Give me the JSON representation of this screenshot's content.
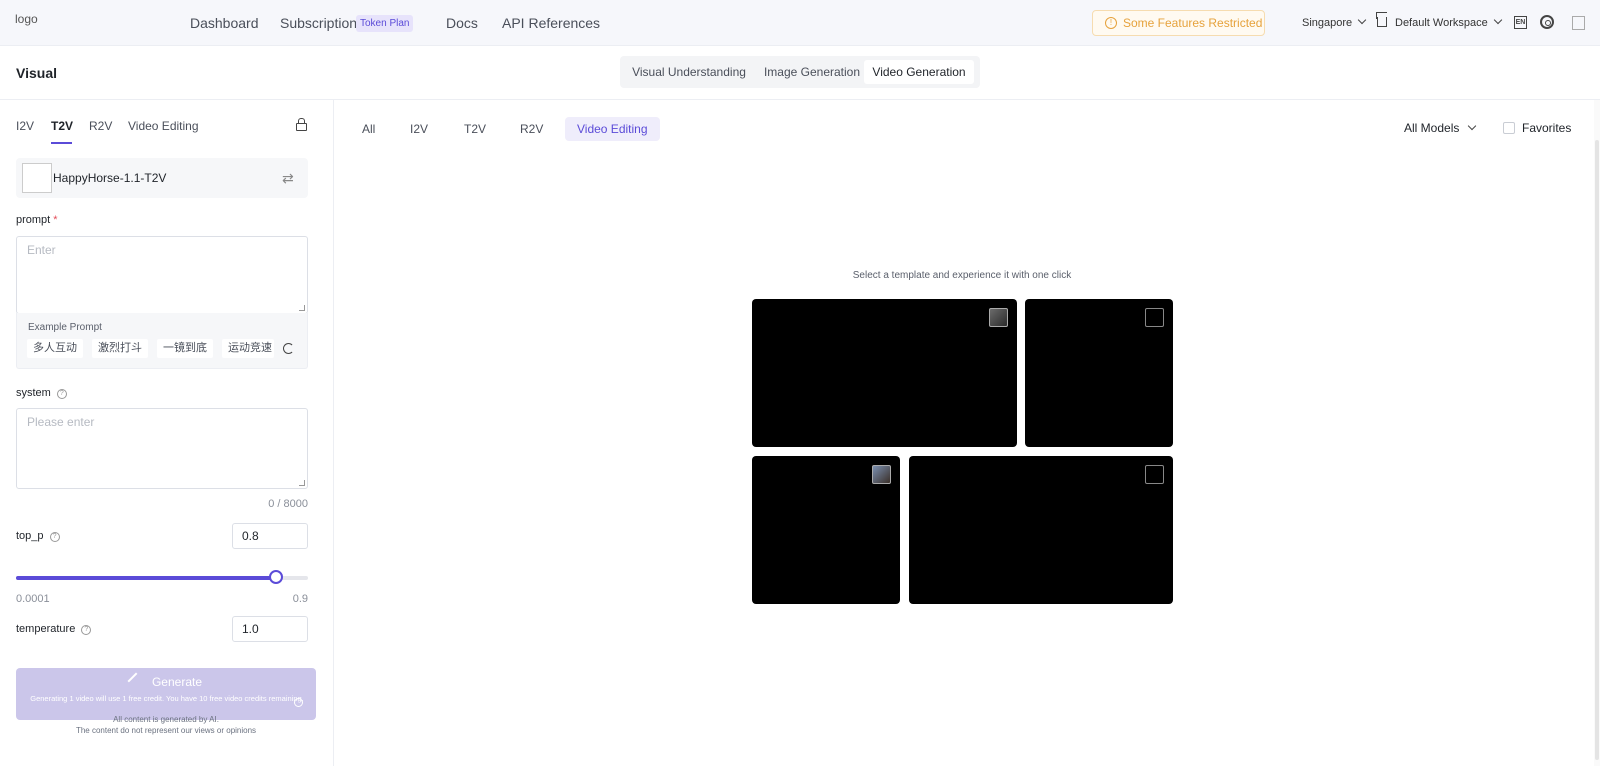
{
  "topnav": {
    "logo_alt": "logo",
    "links": [
      "Dashboard",
      "Subscription",
      "Docs",
      "API References"
    ],
    "subscription_badge": "Token Plan",
    "restricted_notice": "Some Features Restricted",
    "region": "Singapore",
    "workspace": "Default Workspace",
    "language_icon_text": "EN"
  },
  "page": {
    "title": "Visual",
    "segments": [
      "Visual Understanding",
      "Image Generation",
      "Video Generation"
    ],
    "active_segment": "Video Generation"
  },
  "left": {
    "tabs": [
      "I2V",
      "T2V",
      "R2V",
      "Video Editing"
    ],
    "active_tab": "T2V",
    "model_name": "HappyHorse-1.1-T2V",
    "prompt_label": "prompt",
    "prompt_required_mark": "*",
    "prompt_placeholder": "Enter",
    "example_title": "Example Prompt",
    "example_chips": [
      "多人互动",
      "激烈打斗",
      "一镜到底",
      "运动竞速"
    ],
    "system_label": "system",
    "system_placeholder": "Please enter",
    "system_counter": "0 / 8000",
    "top_p_label": "top_p",
    "top_p_value": "0.8",
    "top_p_min": "0.0001",
    "top_p_max": "0.9",
    "top_p_fraction": 0.889,
    "temperature_label": "temperature",
    "temperature_value": "1.0",
    "generate_label": "Generate",
    "generate_note": "Generating 1 video will use 1 free credit. You have 10 free video credits remaining.",
    "disclaimer_1": "All content is generated by AI.",
    "disclaimer_2": "The content do not represent our views or opinions"
  },
  "main": {
    "filter_tabs": [
      "All",
      "I2V",
      "T2V",
      "R2V",
      "Video Editing"
    ],
    "active_filter": "Video Editing",
    "model_filter": "All Models",
    "favorites_label": "Favorites",
    "hint": "Select a template and experience it with one click",
    "template_count": 4
  },
  "colors": {
    "accent": "#5b4bd8",
    "warning": "#e6a23c",
    "template_bg": "#000000"
  }
}
